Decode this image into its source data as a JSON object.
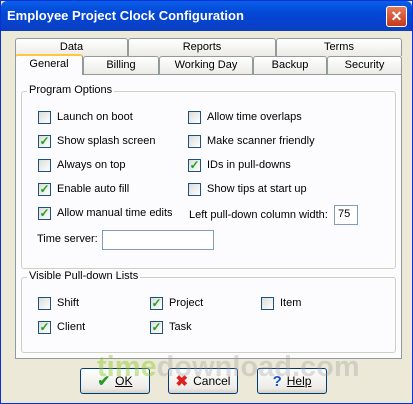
{
  "window": {
    "title": "Employee Project Clock Configuration",
    "close_glyph": "✕"
  },
  "tabs": {
    "back_row": [
      {
        "label": "Data"
      },
      {
        "label": "Reports"
      },
      {
        "label": "Terms"
      }
    ],
    "front_row": [
      {
        "label": "General",
        "active": true
      },
      {
        "label": "Billing"
      },
      {
        "label": "Working Day"
      },
      {
        "label": "Backup"
      },
      {
        "label": "Security"
      }
    ]
  },
  "program_options": {
    "legend": "Program Options",
    "left": [
      {
        "label": "Launch on boot",
        "checked": false
      },
      {
        "label": "Show splash screen",
        "checked": true
      },
      {
        "label": "Always on top",
        "checked": false
      },
      {
        "label": "Enable auto fill",
        "checked": true
      },
      {
        "label": "Allow manual time edits",
        "checked": true
      }
    ],
    "right": [
      {
        "label": "Allow time overlaps",
        "checked": false
      },
      {
        "label": "Make scanner friendly",
        "checked": false
      },
      {
        "label": "IDs in pull-downs",
        "checked": true
      },
      {
        "label": "Show tips at start up",
        "checked": false
      }
    ],
    "column_width_label": "Left pull-down column width:",
    "column_width_value": "75",
    "time_server_label": "Time server:",
    "time_server_value": ""
  },
  "pulldown_lists": {
    "legend": "Visible Pull-down Lists",
    "items": [
      {
        "label": "Shift",
        "checked": false
      },
      {
        "label": "Project",
        "checked": true
      },
      {
        "label": "Item",
        "checked": false
      },
      {
        "label": "Client",
        "checked": true
      },
      {
        "label": "Task",
        "checked": true
      }
    ]
  },
  "buttons": {
    "ok": {
      "label": "OK",
      "icon": "check-icon",
      "glyph": "✔"
    },
    "cancel": {
      "label": "Cancel",
      "icon": "x-icon",
      "glyph": "✖"
    },
    "help": {
      "label": "Help",
      "icon": "help-icon",
      "glyph": "?"
    }
  },
  "watermark": {
    "part1": "time",
    "part2": "download.com"
  },
  "colors": {
    "title_bar": "#0347d6",
    "check": "#21a121",
    "tab_highlight": "#ffc83c"
  }
}
